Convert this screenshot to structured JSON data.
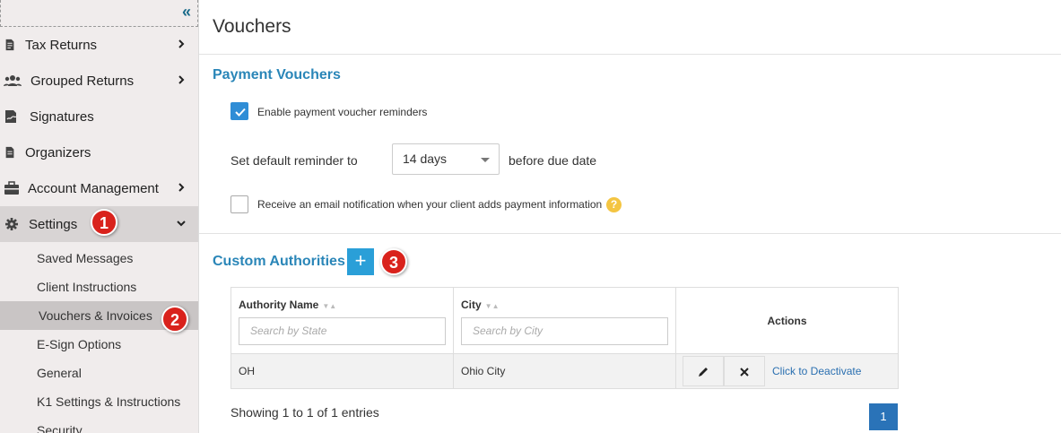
{
  "sidebar": {
    "collapse_label": "«",
    "nav": [
      {
        "label": "Tax Returns",
        "icon": "document-icon"
      },
      {
        "label": "Grouped Returns",
        "icon": "users-icon"
      },
      {
        "label": "Signatures",
        "icon": "signature-icon"
      },
      {
        "label": "Organizers",
        "icon": "organizer-icon"
      },
      {
        "label": "Account Management",
        "icon": "briefcase-icon"
      },
      {
        "label": "Settings",
        "icon": "gear-icon"
      }
    ],
    "settings_items": [
      {
        "label": "Saved Messages"
      },
      {
        "label": "Client Instructions"
      },
      {
        "label": "Vouchers & Invoices"
      },
      {
        "label": "E-Sign Options"
      },
      {
        "label": "General"
      },
      {
        "label": "K1 Settings & Instructions"
      },
      {
        "label": "Security"
      }
    ]
  },
  "annotations": {
    "one": "1",
    "two": "2",
    "three": "3"
  },
  "page": {
    "title": "Vouchers",
    "payment_vouchers": {
      "title": "Payment Vouchers",
      "enable_reminders_label": "Enable payment voucher reminders",
      "enable_reminders_checked": true,
      "default_reminder_prefix": "Set default reminder to",
      "default_reminder_value": "14 days",
      "default_reminder_suffix": "before due date",
      "email_notification_label": "Receive an email notification when your client adds payment information",
      "email_notification_checked": false,
      "help_icon": "?"
    },
    "custom_authorities": {
      "title": "Custom Authorities",
      "add_label": "+",
      "columns": {
        "authority_name": "Authority Name",
        "city": "City",
        "actions": "Actions"
      },
      "filters": {
        "state_placeholder": "Search by State",
        "city_placeholder": "Search by City"
      },
      "rows": [
        {
          "authority": "OH",
          "city": "Ohio City",
          "deactivate_label": "Click to Deactivate"
        }
      ],
      "footer": "Showing 1 to 1 of 1 entries",
      "page": "1"
    }
  },
  "colors": {
    "accent": "#2a86b8",
    "badge": "#d9221c",
    "checkbox": "#2f8dd6",
    "pagination": "#2a73b8"
  }
}
